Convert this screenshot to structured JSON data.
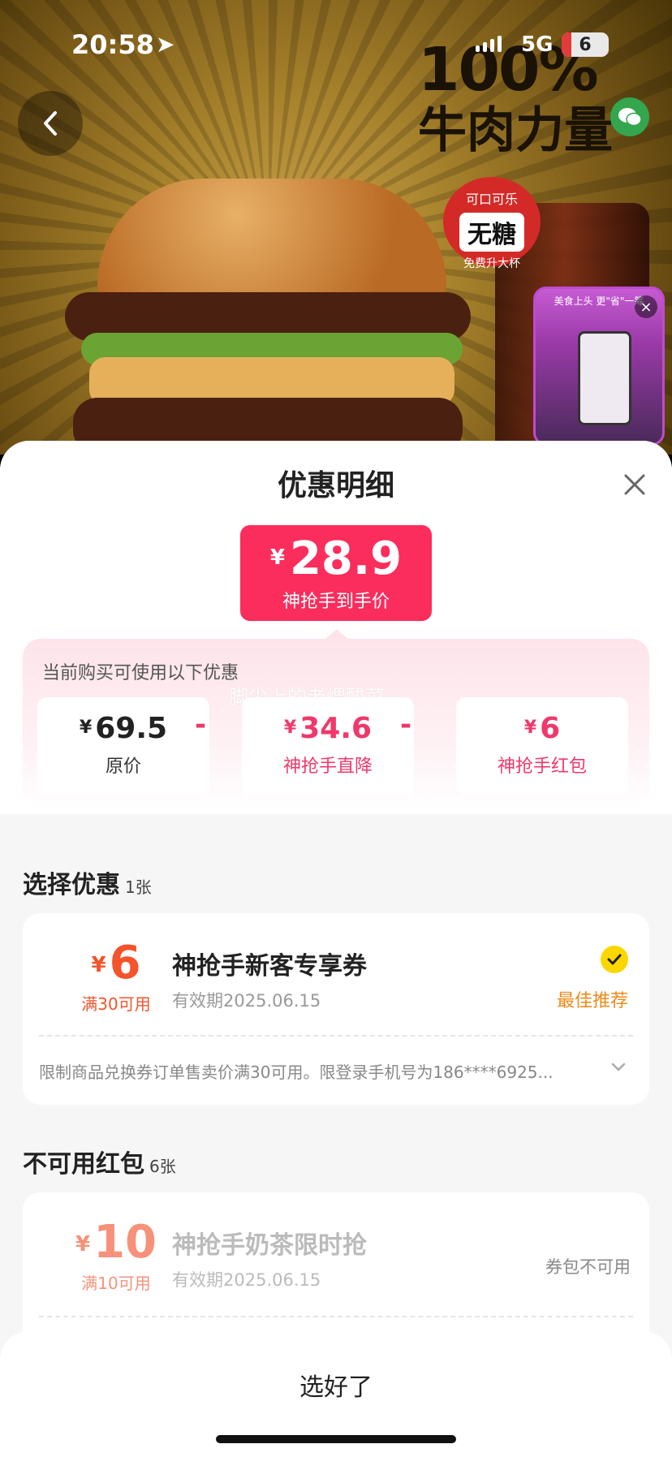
{
  "status_bar": {
    "time": "20:58",
    "network": "5G",
    "battery": "6"
  },
  "hero": {
    "title_line1": "100%",
    "title_line2": "牛肉力量",
    "badge_brand": "可口可乐",
    "badge_main": "无糖",
    "badge_sub": "免费升大杯",
    "floating_video_caption": "美食上头 更\"省\"一筹"
  },
  "sheet": {
    "title": "优惠明细",
    "final_price": {
      "currency": "¥",
      "amount": "28.9",
      "label": "神抢手到手价"
    },
    "calc": {
      "heading": "当前购买可使用以下优惠",
      "watermark": "脚尖上的老煨酸菜",
      "operator": "-",
      "items": [
        {
          "currency": "¥",
          "value": "69.5",
          "label": "原价"
        },
        {
          "currency": "¥",
          "value": "34.6",
          "label": "神抢手直降"
        },
        {
          "currency": "¥",
          "value": "6",
          "label": "神抢手红包"
        }
      ]
    },
    "available": {
      "title": "选择优惠",
      "count": "1张",
      "coupon": {
        "currency": "¥",
        "value": "6",
        "condition": "满30可用",
        "name": "神抢手新客专享券",
        "expiry": "有效期2025.06.15",
        "tag": "最佳推荐",
        "rule": "限制商品兑换券订单售卖价满30可用。限登录手机号为186****6925..."
      }
    },
    "unavailable": {
      "title": "不可用红包",
      "count": "6张",
      "coupon": {
        "currency": "¥",
        "value": "10",
        "condition": "满10可用",
        "name": "神抢手奶茶限时抢",
        "expiry": "有效期2025.06.15",
        "status": "券包不可用"
      }
    },
    "confirm_label": "选好了"
  },
  "colors": {
    "accent": "#fb2d5c",
    "best_tag": "#f08a16",
    "check": "#fcd600"
  }
}
